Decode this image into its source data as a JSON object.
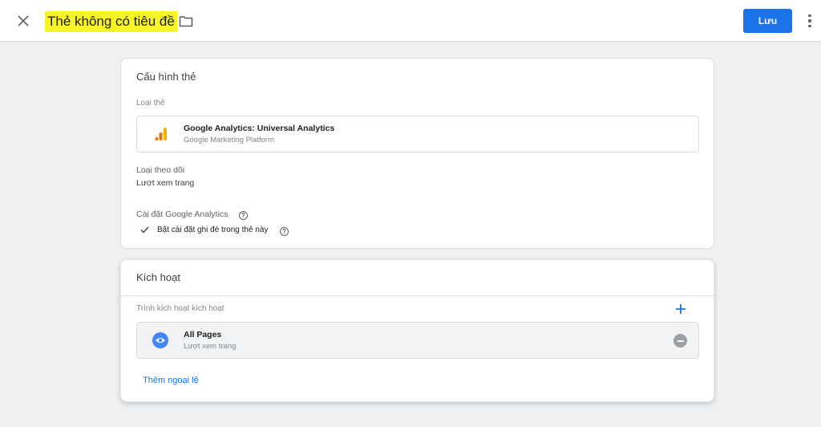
{
  "header": {
    "tag_title": "Thẻ không có tiêu đề",
    "save_label": "Lưu",
    "icons": {
      "close": "close-icon",
      "folder": "folder-icon",
      "more": "more-vert-icon"
    },
    "accent_color": "#1a73e8",
    "title_highlight_color": "#f7f52a"
  },
  "tag_config": {
    "section_title": "Cấu hình thẻ",
    "tag_type_label": "Loại thẻ",
    "tag_type": {
      "name": "Google Analytics: Universal Analytics",
      "provider": "Google Marketing Platform",
      "icon": "google-analytics-icon"
    },
    "track_type_label": "Loại theo dõi",
    "track_type_value": "Lượt xem trang",
    "ga_settings_label": "Cài đặt Google Analytics",
    "override_label": "Bật cài đặt ghi đè trong thẻ này",
    "override_checked": true
  },
  "triggering": {
    "section_title": "Kích hoạt",
    "firing_triggers_label": "Trình kích hoạt kích hoạt",
    "triggers": [
      {
        "name": "All Pages",
        "type": "Lượt xem trang",
        "icon": "eye-icon"
      }
    ],
    "add_exception_label": "Thêm ngoại lệ"
  }
}
